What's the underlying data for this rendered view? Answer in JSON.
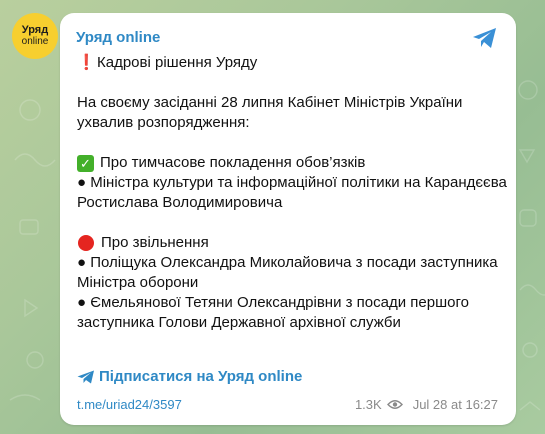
{
  "avatar": {
    "line1": "Уряд",
    "line2": "online"
  },
  "post": {
    "channel_name": "Уряд online",
    "heading": "Кадрові рішення Уряду",
    "intro": "На своєму засіданні 28 липня Кабінет Міністрів України ухвалив розпорядження:",
    "section1_title": "Про тимчасове покладення обов’язків",
    "section1_item": "● Міністра культури та інформаційної політики на Карандєєва Ростислава Володимировича",
    "section2_title": "Про звільнення",
    "section2_item1": "● Поліщука Олександра Миколайовича з посади заступника Міністра оборони",
    "section2_item2": "● Ємельянової Тетяни Олександрівни з посади першого заступника Голови Державної архівної служби",
    "subscribe_label": "Підписатися на Уряд online",
    "link": "t.me/uriad24/3597",
    "views": "1.3K",
    "timestamp": "Jul 28 at 16:27"
  },
  "colors": {
    "accent": "#2f89c5",
    "avatar_bg": "#f7cf2f",
    "check": "#43b02a",
    "red": "#e52520"
  },
  "icons": [
    "share-icon",
    "exclamation-icon",
    "check-icon",
    "red-circle-icon",
    "telegram-icon",
    "eye-icon"
  ]
}
